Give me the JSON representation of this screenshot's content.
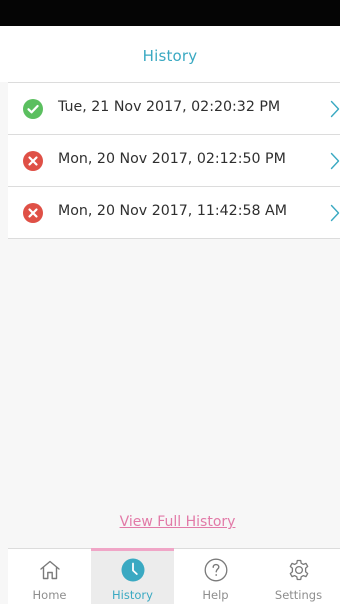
{
  "header": {
    "title": "History"
  },
  "history": {
    "items": [
      {
        "status": "success",
        "status_icon": "check-circle-icon",
        "label": "Tue, 21 Nov 2017, 02:20:32 PM"
      },
      {
        "status": "failed",
        "status_icon": "x-circle-icon",
        "label": "Mon, 20 Nov 2017, 02:12:50 PM"
      },
      {
        "status": "failed",
        "status_icon": "x-circle-icon",
        "label": "Mon, 20 Nov 2017, 11:42:58 AM"
      }
    ],
    "view_full_label": "View Full History"
  },
  "tabbar": {
    "tabs": [
      {
        "label": "Home",
        "icon": "home-icon",
        "active": false
      },
      {
        "label": "History",
        "icon": "clock-icon",
        "active": true
      },
      {
        "label": "Help",
        "icon": "question-icon",
        "active": false
      },
      {
        "label": "Settings",
        "icon": "gear-icon",
        "active": false
      }
    ]
  },
  "colors": {
    "accent": "#3aa9c2",
    "success": "#5bbf5f",
    "error": "#df5046",
    "link": "#e27aa8",
    "active_tab_indicator": "#f0a6c7"
  }
}
